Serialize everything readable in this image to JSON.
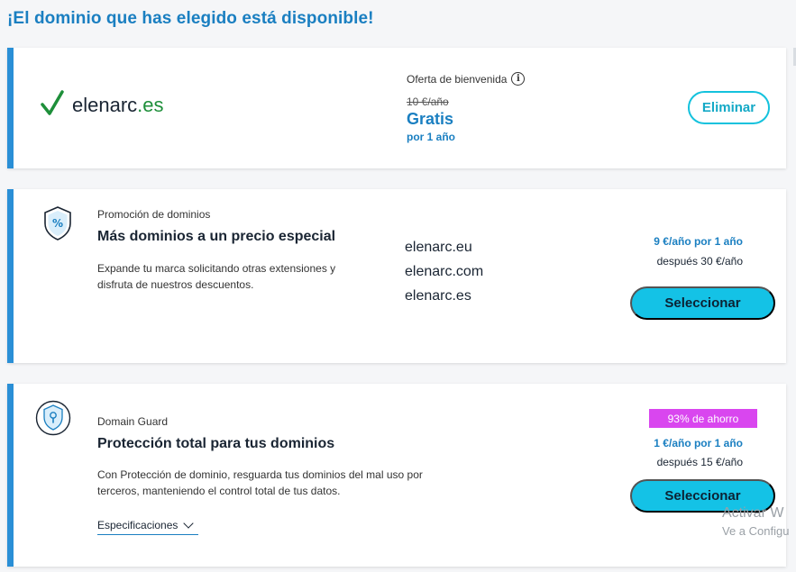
{
  "page": {
    "title": "¡El dominio que has elegido está disponible!"
  },
  "domain_card": {
    "domain_base": "elenarc",
    "domain_tld": ".es",
    "offer_label": "Oferta de bienvenida",
    "old_price": "10 €/año",
    "new_price": "Gratis",
    "period": "por 1 año",
    "remove_label": "Eliminar",
    "accent_color": "#1e8f3a"
  },
  "promo_card": {
    "eyebrow": "Promoción de dominios",
    "heading": "Más dominios a un precio especial",
    "description": "Expande tu marca solicitando otras extensiones y disfruta de nuestros descuentos.",
    "domains": [
      "elenarc.eu",
      "elenarc.com",
      "elenarc.es"
    ],
    "price": "9 €/año por 1 año",
    "after_price": "después 30 €/año",
    "select_label": "Seleccionar",
    "icon": "percent-shield-icon"
  },
  "guard_card": {
    "eyebrow": "Domain Guard",
    "heading": "Protección total para tus dominios",
    "description": "Con Protección de dominio, resguarda tus dominios del mal uso por terceros, manteniendo el control total de tus datos.",
    "badge": "93% de ahorro",
    "price": "1 €/año por 1 año",
    "after_price": "después 15 €/año",
    "select_label": "Seleccionar",
    "specs_label": "Especificaciones",
    "icon": "lock-shield-icon",
    "badge_color": "#d946ef"
  },
  "watermark": {
    "line1": "Activar W",
    "line2": "Ve a Configu"
  },
  "colors": {
    "primary_blue": "#1a7fc1",
    "accent_cyan": "#14c2e6",
    "card_border": "#2a8fd6"
  }
}
